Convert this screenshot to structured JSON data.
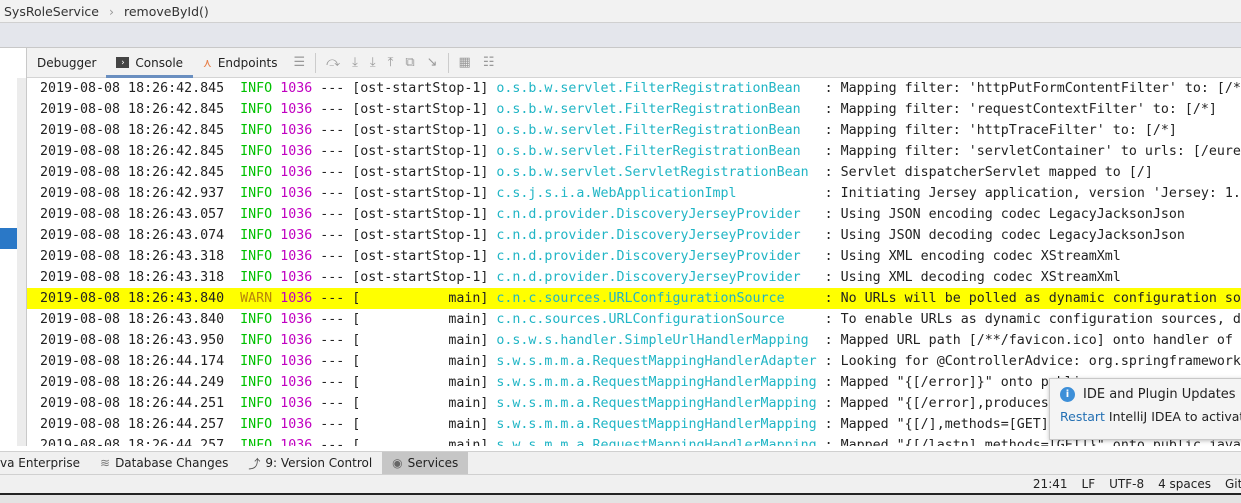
{
  "breadcrumb": {
    "items": [
      "SysRoleService",
      "removeById()"
    ],
    "separator": "›"
  },
  "tabs": [
    {
      "label": "Debugger",
      "icon": "",
      "active": false
    },
    {
      "label": "Console",
      "icon": "console-icon",
      "active": true
    },
    {
      "label": "Endpoints",
      "icon": "endpoints-icon",
      "active": false
    }
  ],
  "debug_toolbar_icons": [
    "menu-icon",
    "step-over-icon",
    "step-into-icon",
    "force-step-into-icon",
    "step-out-icon",
    "drop-frame-icon",
    "run-to-cursor-icon",
    "evaluate-icon",
    "settings-icon"
  ],
  "log": {
    "lines": [
      {
        "ts": "2019-08-08 18:26:42.845",
        "level": "INFO",
        "pid": "1036",
        "thread": "ost-startStop-1",
        "logger": "o.s.b.w.servlet.FilterRegistrationBean",
        "msg": "Mapping filter: 'httpPutFormContentFilter' to: [/*"
      },
      {
        "ts": "2019-08-08 18:26:42.845",
        "level": "INFO",
        "pid": "1036",
        "thread": "ost-startStop-1",
        "logger": "o.s.b.w.servlet.FilterRegistrationBean",
        "msg": "Mapping filter: 'requestContextFilter' to: [/*]"
      },
      {
        "ts": "2019-08-08 18:26:42.845",
        "level": "INFO",
        "pid": "1036",
        "thread": "ost-startStop-1",
        "logger": "o.s.b.w.servlet.FilterRegistrationBean",
        "msg": "Mapping filter: 'httpTraceFilter' to: [/*]"
      },
      {
        "ts": "2019-08-08 18:26:42.845",
        "level": "INFO",
        "pid": "1036",
        "thread": "ost-startStop-1",
        "logger": "o.s.b.w.servlet.FilterRegistrationBean",
        "msg": "Mapping filter: 'servletContainer' to urls: [/eure"
      },
      {
        "ts": "2019-08-08 18:26:42.845",
        "level": "INFO",
        "pid": "1036",
        "thread": "ost-startStop-1",
        "logger": "o.s.b.w.servlet.ServletRegistrationBean",
        "msg": "Servlet dispatcherServlet mapped to [/]"
      },
      {
        "ts": "2019-08-08 18:26:42.937",
        "level": "INFO",
        "pid": "1036",
        "thread": "ost-startStop-1",
        "logger": "c.s.j.s.i.a.WebApplicationImpl",
        "msg": "Initiating Jersey application, version 'Jersey: 1."
      },
      {
        "ts": "2019-08-08 18:26:43.057",
        "level": "INFO",
        "pid": "1036",
        "thread": "ost-startStop-1",
        "logger": "c.n.d.provider.DiscoveryJerseyProvider",
        "msg": "Using JSON encoding codec LegacyJacksonJson"
      },
      {
        "ts": "2019-08-08 18:26:43.074",
        "level": "INFO",
        "pid": "1036",
        "thread": "ost-startStop-1",
        "logger": "c.n.d.provider.DiscoveryJerseyProvider",
        "msg": "Using JSON decoding codec LegacyJacksonJson"
      },
      {
        "ts": "2019-08-08 18:26:43.318",
        "level": "INFO",
        "pid": "1036",
        "thread": "ost-startStop-1",
        "logger": "c.n.d.provider.DiscoveryJerseyProvider",
        "msg": "Using XML encoding codec XStreamXml"
      },
      {
        "ts": "2019-08-08 18:26:43.318",
        "level": "INFO",
        "pid": "1036",
        "thread": "ost-startStop-1",
        "logger": "c.n.d.provider.DiscoveryJerseyProvider",
        "msg": "Using XML decoding codec XStreamXml"
      },
      {
        "ts": "2019-08-08 18:26:43.840",
        "level": "WARN",
        "pid": "1036",
        "thread": "main",
        "logger": "c.n.c.sources.URLConfigurationSource",
        "msg": "No URLs will be polled as dynamic configuration so"
      },
      {
        "ts": "2019-08-08 18:26:43.840",
        "level": "INFO",
        "pid": "1036",
        "thread": "main",
        "logger": "c.n.c.sources.URLConfigurationSource",
        "msg": "To enable URLs as dynamic configuration sources, d"
      },
      {
        "ts": "2019-08-08 18:26:43.950",
        "level": "INFO",
        "pid": "1036",
        "thread": "main",
        "logger": "o.s.w.s.handler.SimpleUrlHandlerMapping",
        "msg": "Mapped URL path [/**/favicon.ico] onto handler of"
      },
      {
        "ts": "2019-08-08 18:26:44.174",
        "level": "INFO",
        "pid": "1036",
        "thread": "main",
        "logger": "s.w.s.m.m.a.RequestMappingHandlerAdapter",
        "msg": "Looking for @ControllerAdvice: org.springframework"
      },
      {
        "ts": "2019-08-08 18:26:44.249",
        "level": "INFO",
        "pid": "1036",
        "thread": "main",
        "logger": "s.w.s.m.m.a.RequestMappingHandlerMapping",
        "msg": "Mapped \"{[/error]}\" onto public"
      },
      {
        "ts": "2019-08-08 18:26:44.251",
        "level": "INFO",
        "pid": "1036",
        "thread": "main",
        "logger": "s.w.s.m.m.a.RequestMappingHandlerMapping",
        "msg": "Mapped \"{[/error],produces"
      },
      {
        "ts": "2019-08-08 18:26:44.257",
        "level": "INFO",
        "pid": "1036",
        "thread": "main",
        "logger": "s.w.s.m.m.a.RequestMappingHandlerMapping",
        "msg": "Mapped \"{[/],methods=[GET]"
      },
      {
        "ts": "2019-08-08 18:26:44.257",
        "level": "INFO",
        "pid": "1036",
        "thread": "main",
        "logger": "s.w.s.m.m.a.RequestMappingHandlerMapping",
        "msg": "Mapped \"{[/lastn],methods=[GET]}\" onto public java"
      }
    ]
  },
  "notification": {
    "title": "IDE and Plugin Updates",
    "link": "Restart",
    "text": " IntelliJ IDEA to activat",
    "icon": "info-icon"
  },
  "bottom_tabs": [
    {
      "label": "va Enterprise",
      "icon": ""
    },
    {
      "label": "Database Changes",
      "icon": "database-icon"
    },
    {
      "label": "9: Version Control",
      "icon": "version-control-icon"
    },
    {
      "label": "Services",
      "icon": "services-icon",
      "active": true
    }
  ],
  "status": {
    "position": "21:41",
    "line_ending": "LF",
    "encoding": "UTF-8",
    "indent": "4 spaces",
    "vcs": "Git"
  },
  "colors": {
    "info": "#00c000",
    "warn_bg": "#ffff00",
    "pid": "#c000c0",
    "logger": "#20b5c5",
    "selection": "#2a78c7"
  }
}
